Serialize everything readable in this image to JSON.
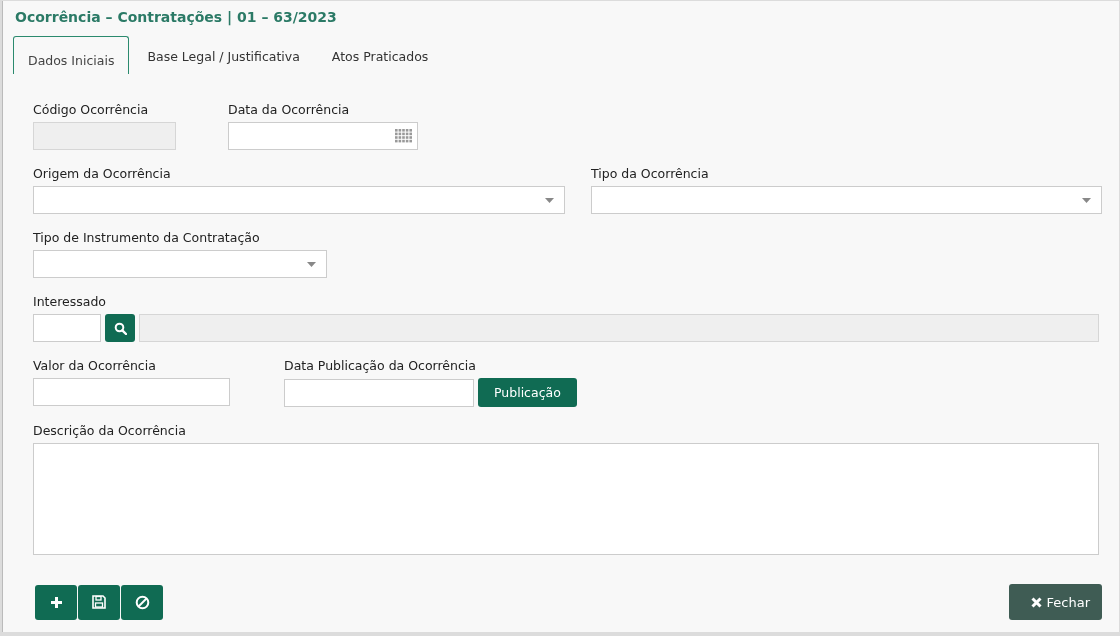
{
  "window": {
    "title": "Ocorrência – Contratações | 01 – 63/2023"
  },
  "tabs": [
    {
      "label": "Dados Iniciais",
      "selected": true
    },
    {
      "label": "Base Legal / Justificativa",
      "selected": false
    },
    {
      "label": "Atos Praticados",
      "selected": false
    }
  ],
  "rows": [
    [
      {
        "kind": "text",
        "label": "Código Ocorrência",
        "disabled": true
      },
      {
        "kind": "date",
        "label": "Data da Ocorrência",
        "disabled": false
      }
    ],
    [
      {
        "kind": "select",
        "label": "Origem da Ocorrência",
        "disabled": false
      },
      {
        "kind": "select",
        "label": "Tipo da Ocorrência",
        "disabled": false
      }
    ],
    [
      {
        "kind": "select",
        "label": "Tipo de Instrumento da Contratação",
        "disabled": false
      }
    ],
    [
      {
        "kind": "lookup",
        "label": "Interessado",
        "disabled": false
      }
    ],
    [
      {
        "kind": "text",
        "label": "Valor da Ocorrência",
        "disabled": false
      },
      {
        "kind": "action",
        "label": "Data Publicação da Ocorrência",
        "disabled": false,
        "button": "Publicação"
      }
    ],
    [
      {
        "kind": "textarea",
        "label": "Descrição da Ocorrência",
        "disabled": false
      }
    ]
  ],
  "close_button": "Fechar"
}
